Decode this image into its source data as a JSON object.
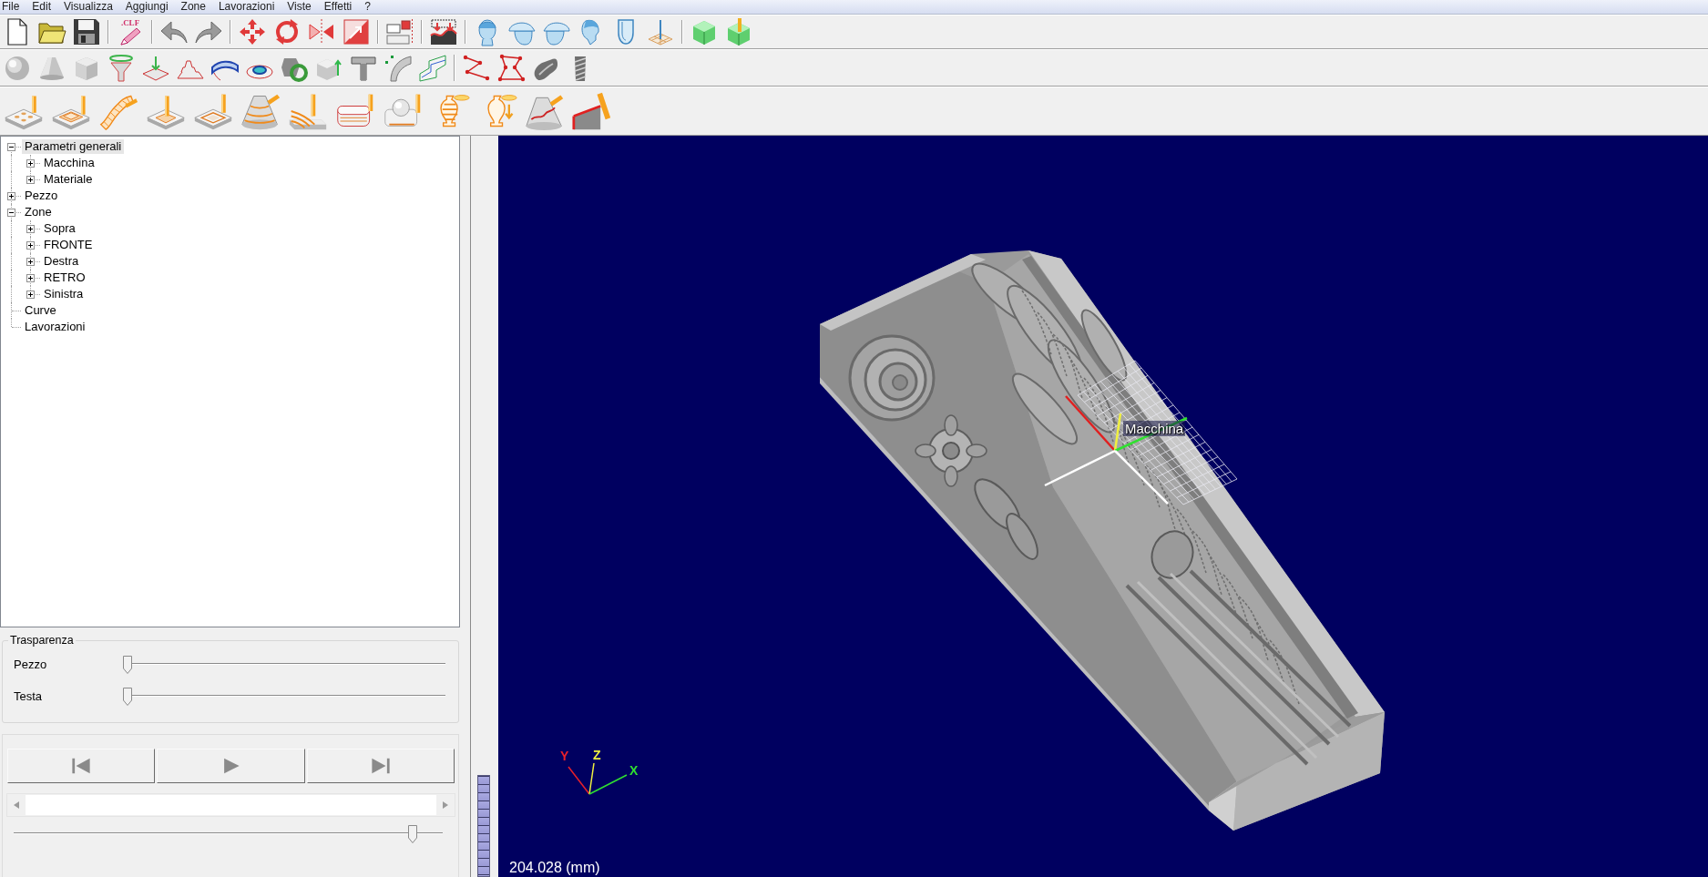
{
  "menu_bar": [
    "File",
    "Edit",
    "Visualizza",
    "Aggiungi",
    "Zone",
    "Lavorazioni",
    "Viste",
    "Effetti",
    "?"
  ],
  "toolbar": {
    "export_caption": ".CLF"
  },
  "tree": [
    {
      "label": "Parametri generali",
      "expanded": true,
      "selected": true,
      "children": [
        {
          "label": "Macchina",
          "expanded": false,
          "selected": false
        },
        {
          "label": "Materiale",
          "expanded": false,
          "selected": false
        }
      ]
    },
    {
      "label": "Pezzo",
      "expanded": false,
      "selected": false
    },
    {
      "label": "Zone",
      "expanded": true,
      "selected": false,
      "children": [
        {
          "label": "Sopra",
          "expanded": false,
          "selected": false
        },
        {
          "label": "FRONTE",
          "expanded": false,
          "selected": false
        },
        {
          "label": "Destra",
          "expanded": false,
          "selected": false
        },
        {
          "label": "RETRO",
          "expanded": false,
          "selected": false
        },
        {
          "label": "Sinistra",
          "expanded": false,
          "selected": false
        }
      ]
    },
    {
      "label": "Curve",
      "selected": false
    },
    {
      "label": "Lavorazioni",
      "selected": false
    }
  ],
  "transparency": {
    "title": "Trasparenza",
    "sliders": [
      {
        "label": "Pezzo",
        "level": 0
      },
      {
        "label": "Testa",
        "level": 0
      }
    ]
  },
  "playback": {
    "slider": {
      "level": 0.94
    }
  },
  "viewport": {
    "object_label": "Macchina",
    "axes": [
      {
        "label": "Y",
        "color": "#e8202a"
      },
      {
        "label": "Z",
        "color": "#f0f040"
      },
      {
        "label": "X",
        "color": "#30e030"
      }
    ],
    "scale_readout": "204.028 (mm)"
  }
}
